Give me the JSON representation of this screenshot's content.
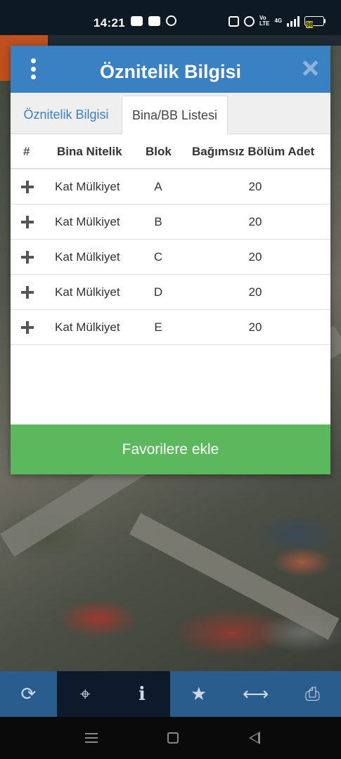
{
  "status_bar": {
    "time": "14:21",
    "battery_level": "98",
    "network_label": "4G"
  },
  "dialog": {
    "title": "Öznitelik Bilgisi",
    "tabs": [
      {
        "label": "Öznitelik Bilgisi",
        "active": false
      },
      {
        "label": "Bina/BB Listesi",
        "active": true
      }
    ],
    "table": {
      "headers": [
        "#",
        "Bina Nitelik",
        "Blok",
        "Bağımsız Bölüm Adet"
      ],
      "rows": [
        {
          "nitelik": "Kat Mülkiyet",
          "blok": "A",
          "adet": "20"
        },
        {
          "nitelik": "Kat Mülkiyet",
          "blok": "B",
          "adet": "20"
        },
        {
          "nitelik": "Kat Mülkiyet",
          "blok": "C",
          "adet": "20"
        },
        {
          "nitelik": "Kat Mülkiyet",
          "blok": "D",
          "adet": "20"
        },
        {
          "nitelik": "Kat Mülkiyet",
          "blok": "E",
          "adet": "20"
        }
      ]
    },
    "favorite_button": "Favorilere ekle"
  },
  "toolbar": {
    "buttons": [
      {
        "icon": "refresh-icon",
        "glyph": "⟳"
      },
      {
        "icon": "crosshair-icon",
        "glyph": "⌖"
      },
      {
        "icon": "info-icon",
        "glyph": "i"
      },
      {
        "icon": "star-icon",
        "glyph": "★"
      },
      {
        "icon": "measure-icon",
        "glyph": "⟷"
      },
      {
        "icon": "print-icon",
        "glyph": "⎙"
      }
    ]
  }
}
